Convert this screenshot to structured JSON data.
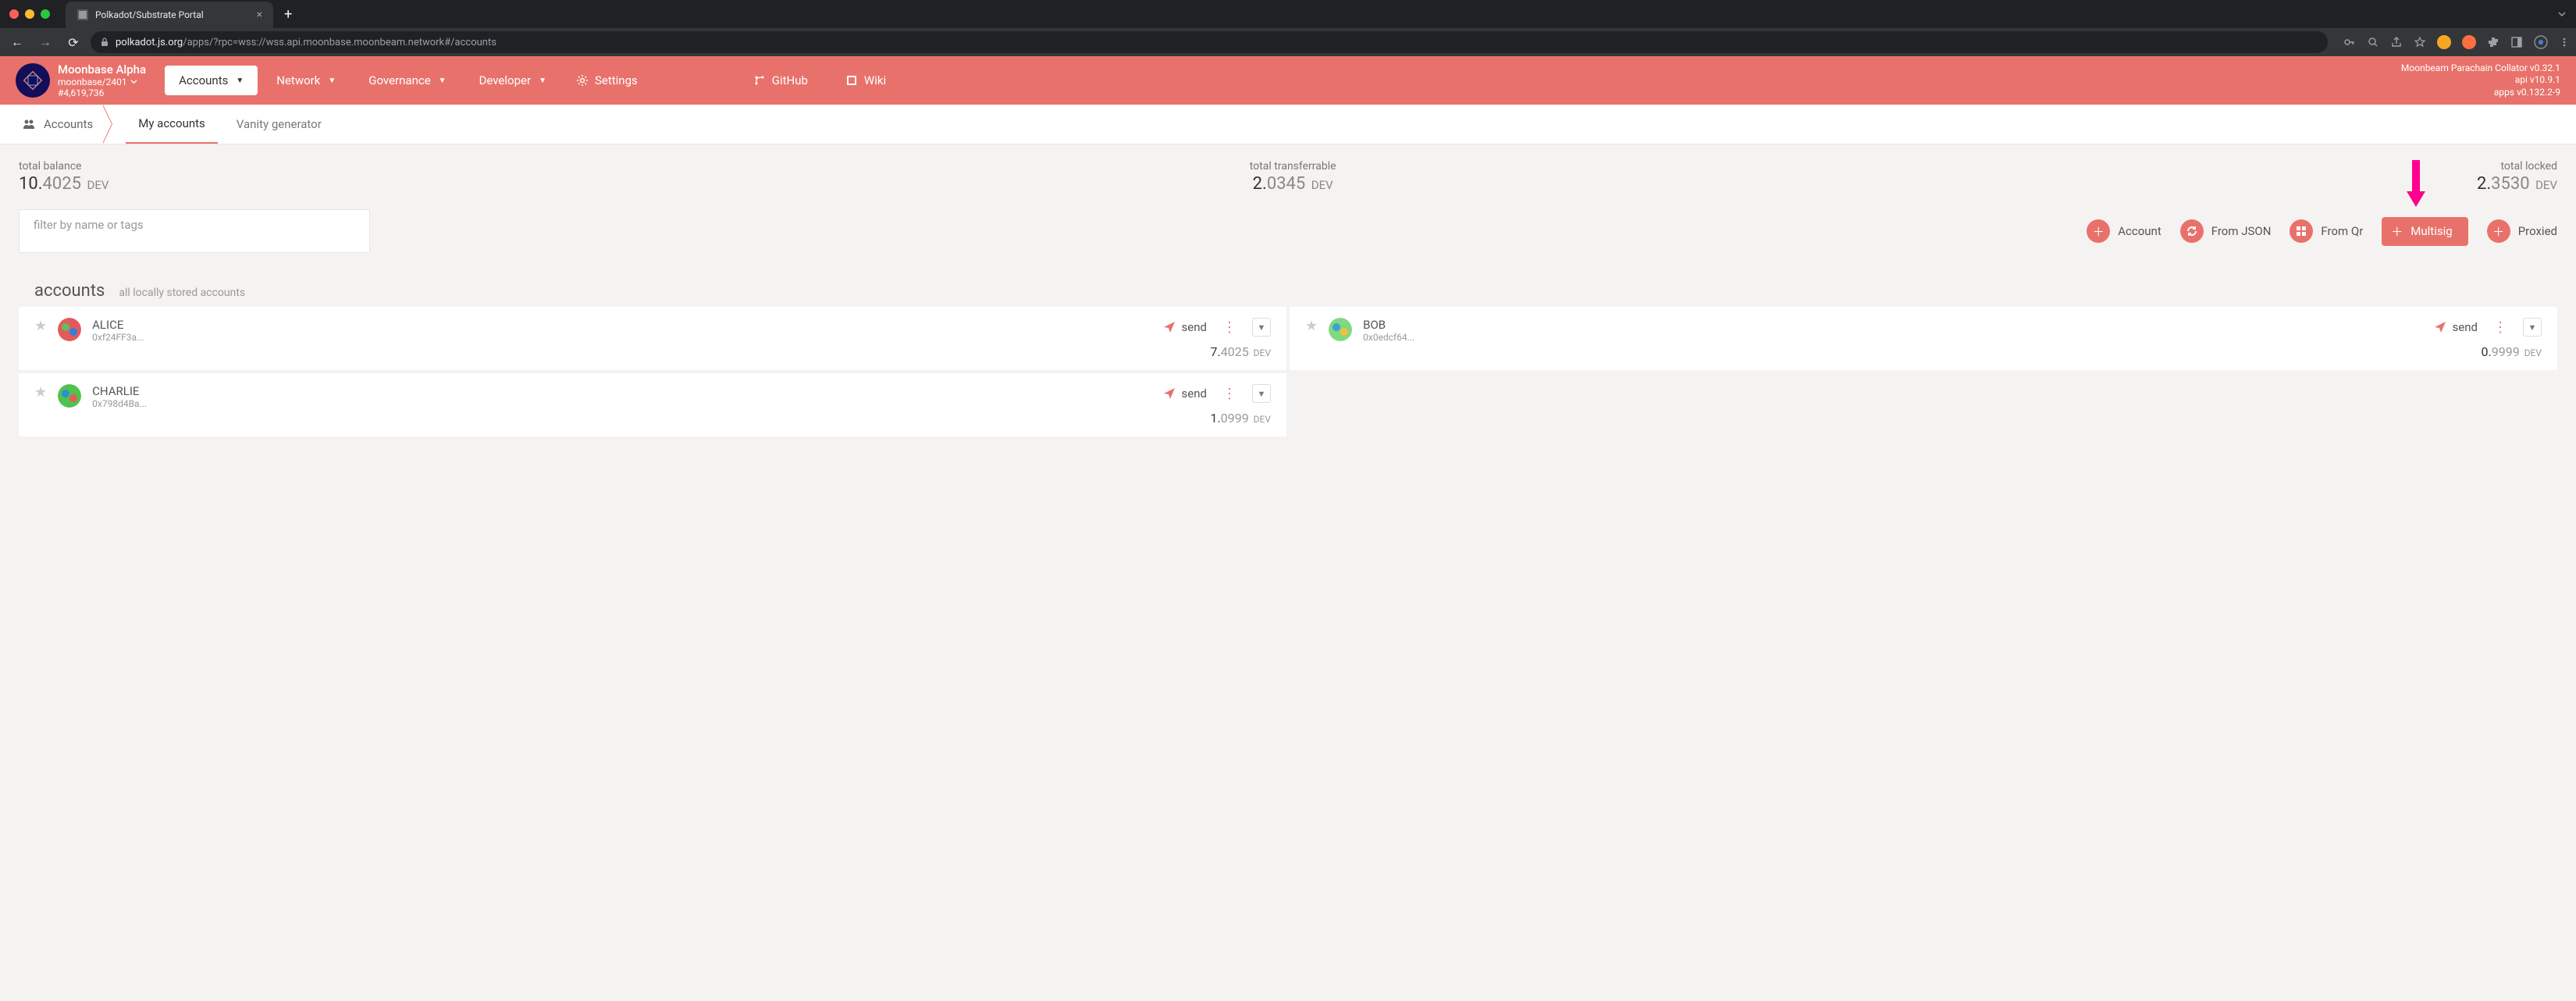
{
  "browser": {
    "tab_title": "Polkadot/Substrate Portal",
    "url_host": "polkadot.js.org",
    "url_path": "/apps/?rpc=wss://wss.api.moonbase.moonbeam.network#/accounts"
  },
  "network": {
    "name": "Moonbase Alpha",
    "chain": "moonbase/2401",
    "block": "#4,619,736"
  },
  "main_nav": {
    "accounts": "Accounts",
    "network": "Network",
    "governance": "Governance",
    "developer": "Developer",
    "settings": "Settings",
    "github": "GitHub",
    "wiki": "Wiki"
  },
  "versions": {
    "line1": "Moonbeam Parachain Collator v0.32.1",
    "line2": "api v10.9.1",
    "line3": "apps v0.132.2-9"
  },
  "sub_nav": {
    "crumb": "Accounts",
    "my_accounts": "My accounts",
    "vanity": "Vanity generator"
  },
  "totals": {
    "balance_label": "total balance",
    "balance_int": "10.",
    "balance_dec": "4025",
    "transferrable_label": "total transferrable",
    "transferrable_int": "2.",
    "transferrable_dec": "0345",
    "locked_label": "total locked",
    "locked_int": "2.",
    "locked_dec": "3530",
    "unit": "DEV"
  },
  "filter_placeholder": "filter by name or tags",
  "actions": {
    "account": "Account",
    "from_json": "From JSON",
    "from_qr": "From Qr",
    "multisig": "Multisig",
    "proxied": "Proxied"
  },
  "accounts_section": {
    "title": "accounts",
    "subtitle": "all locally stored accounts"
  },
  "accounts": [
    {
      "name": "ALICE",
      "addr": "0xf24FF3a...",
      "bal_int": "7.",
      "bal_dec": "4025",
      "unit": "DEV",
      "avatar_colors": [
        "#e45a5a",
        "#5fbf5f",
        "#2f7fe0"
      ]
    },
    {
      "name": "BOB",
      "addr": "0x0edcf64...",
      "bal_int": "0.",
      "bal_dec": "9999",
      "unit": "DEV",
      "avatar_colors": [
        "#7fd97f",
        "#3fa0d8",
        "#f0c040"
      ]
    },
    {
      "name": "CHARLIE",
      "addr": "0x798d4Ba...",
      "bal_int": "1.",
      "bal_dec": "0999",
      "unit": "DEV",
      "avatar_colors": [
        "#4fc24f",
        "#2f8fd0",
        "#e85a5a"
      ]
    }
  ],
  "send_label": "send"
}
